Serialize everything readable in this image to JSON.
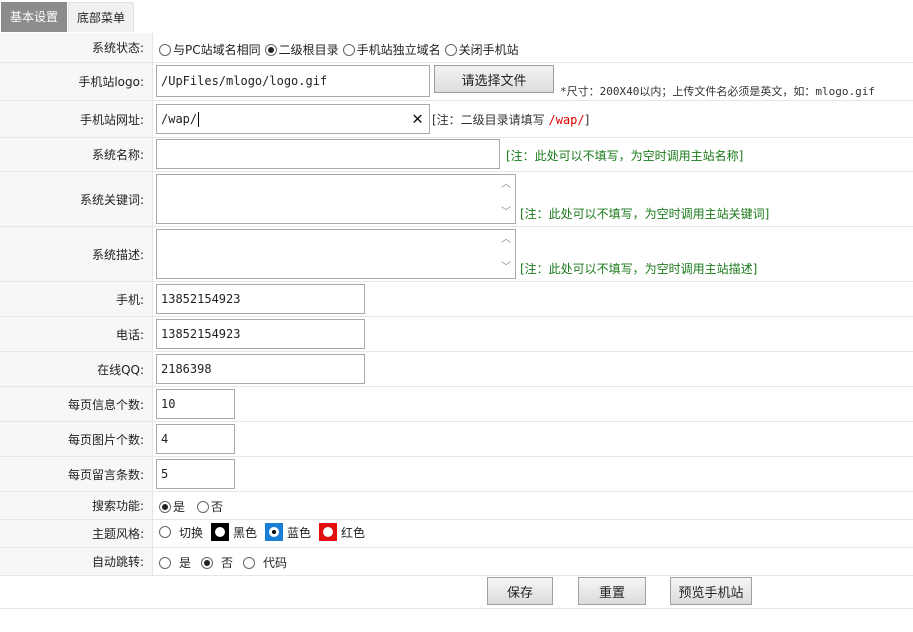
{
  "tabs": [
    {
      "label": "基本设置"
    },
    {
      "label": "底部菜单"
    }
  ],
  "fields": {
    "status": {
      "label": "系统状态:",
      "options": [
        "与PC站域名相同",
        "二级根目录",
        "手机站独立域名",
        "关闭手机站"
      ],
      "selected": "二级根目录"
    },
    "logo": {
      "label": "手机站logo:",
      "value": "/UpFiles/mlogo/logo.gif",
      "button": "请选择文件",
      "note": "*尺寸：200X40以内；上传文件名必须是英文，如：mlogo.gif"
    },
    "url": {
      "label": "手机站网址:",
      "value": "/wap/",
      "note_prefix": "[注：二级目录请填写 ",
      "note_red": "/wap/",
      "note_suffix": "]"
    },
    "name": {
      "label": "系统名称:",
      "value": "",
      "note": "[注：此处可以不填写，为空时调用主站名称]"
    },
    "keywords": {
      "label": "系统关键词:",
      "value": "",
      "note": "[注：此处可以不填写，为空时调用主站关键词]"
    },
    "description": {
      "label": "系统描述:",
      "value": "",
      "note": "[注：此处可以不填写，为空时调用主站描述]"
    },
    "mobile": {
      "label": "手机:",
      "value": "13852154923"
    },
    "phone": {
      "label": "电话:",
      "value": "13852154923"
    },
    "qq": {
      "label": "在线QQ:",
      "value": "2186398"
    },
    "per_page_info": {
      "label": "每页信息个数:",
      "value": "10"
    },
    "per_page_images": {
      "label": "每页图片个数:",
      "value": "4"
    },
    "per_page_messages": {
      "label": "每页留言条数:",
      "value": "5"
    },
    "search": {
      "label": "搜索功能:",
      "options": [
        "是",
        "否"
      ],
      "selected": "是"
    },
    "theme": {
      "label": "主题风格:",
      "options": [
        "切换",
        "黑色",
        "蓝色",
        "红色"
      ],
      "selected": "蓝色",
      "swatch_colors": {
        "黑色": "#000000",
        "蓝色": "#1a7fd4",
        "红色": "#e01010"
      }
    },
    "redirect": {
      "label": "自动跳转:",
      "options": [
        "是",
        "否",
        "代码"
      ],
      "selected": "否"
    }
  },
  "actions": {
    "save": "保存",
    "reset": "重置",
    "preview": "预览手机站"
  }
}
